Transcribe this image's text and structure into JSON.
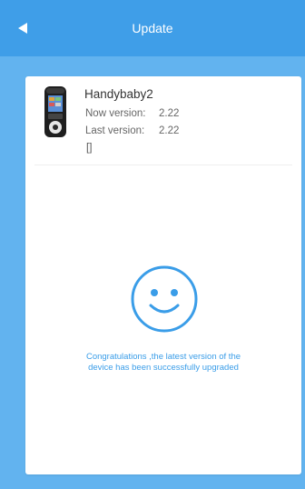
{
  "header": {
    "title": "Update",
    "back_icon": "back-arrow-icon",
    "color": "#3f9ee8"
  },
  "background_color": "#62b3ef",
  "device": {
    "name": "Handybaby2",
    "image_icon": "handheld-device-icon",
    "now_version_label": "Now version:",
    "now_version_value": "2.22",
    "last_version_label": "Last version:",
    "last_version_value": "2.22",
    "extra_text": "[]"
  },
  "status": {
    "icon": "smiley-face-icon",
    "message_line1": "Congratulations ,the latest version of the",
    "message_line2": "device has been successfully upgraded",
    "accent_color": "#3a9de8"
  }
}
